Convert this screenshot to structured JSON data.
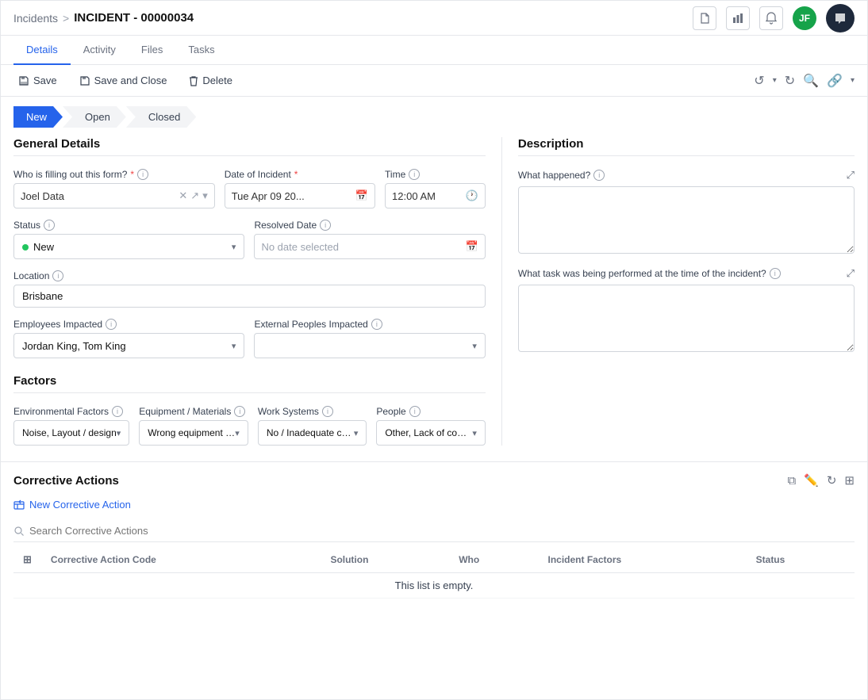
{
  "topbar": {
    "breadcrumb_link": "Incidents",
    "breadcrumb_sep": ">",
    "breadcrumb_current": "INCIDENT - 00000034",
    "avatar_initials": "JF"
  },
  "tabs": [
    {
      "id": "details",
      "label": "Details",
      "active": true
    },
    {
      "id": "activity",
      "label": "Activity",
      "active": false
    },
    {
      "id": "files",
      "label": "Files",
      "active": false
    },
    {
      "id": "tasks",
      "label": "Tasks",
      "active": false
    }
  ],
  "toolbar": {
    "save_label": "Save",
    "save_close_label": "Save and Close",
    "delete_label": "Delete"
  },
  "status_steps": [
    {
      "id": "new",
      "label": "New",
      "active": true
    },
    {
      "id": "open",
      "label": "Open",
      "active": false
    },
    {
      "id": "closed",
      "label": "Closed",
      "active": false
    }
  ],
  "general_details": {
    "title": "General Details",
    "who_label": "Who is filling out this form?",
    "who_required": true,
    "who_value": "Joel Data",
    "date_label": "Date of Incident",
    "date_required": true,
    "date_value": "Tue Apr 09 20...",
    "time_label": "Time",
    "time_value": "12:00 AM",
    "status_label": "Status",
    "status_value": "New",
    "resolved_date_label": "Resolved Date",
    "resolved_date_placeholder": "No date selected",
    "location_label": "Location",
    "location_value": "Brisbane",
    "employees_label": "Employees Impacted",
    "employees_value": "Jordan King, Tom King",
    "external_label": "External Peoples Impacted",
    "external_value": ""
  },
  "description": {
    "title": "Description",
    "what_happened_label": "What happened?",
    "what_happened_value": "",
    "task_label": "What task was being performed at the time of the incident?",
    "task_value": ""
  },
  "factors": {
    "title": "Factors",
    "environmental_label": "Environmental Factors",
    "environmental_value": "Noise, Layout / design",
    "equipment_label": "Equipment / Materials",
    "equipment_value": "Wrong equipment for the job, Equipme...",
    "work_systems_label": "Work Systems",
    "work_systems_value": "No / Inadequate controls implemente...",
    "people_label": "People",
    "people_value": "Other, Lack of communication"
  },
  "corrective_actions": {
    "title": "Corrective Actions",
    "new_button_label": "New Corrective Action",
    "search_placeholder": "Search Corrective Actions",
    "columns": [
      {
        "id": "code",
        "label": "Corrective Action Code"
      },
      {
        "id": "solution",
        "label": "Solution"
      },
      {
        "id": "who",
        "label": "Who"
      },
      {
        "id": "factors",
        "label": "Incident Factors"
      },
      {
        "id": "status",
        "label": "Status"
      }
    ],
    "empty_message": "This list is empty.",
    "rows": []
  }
}
